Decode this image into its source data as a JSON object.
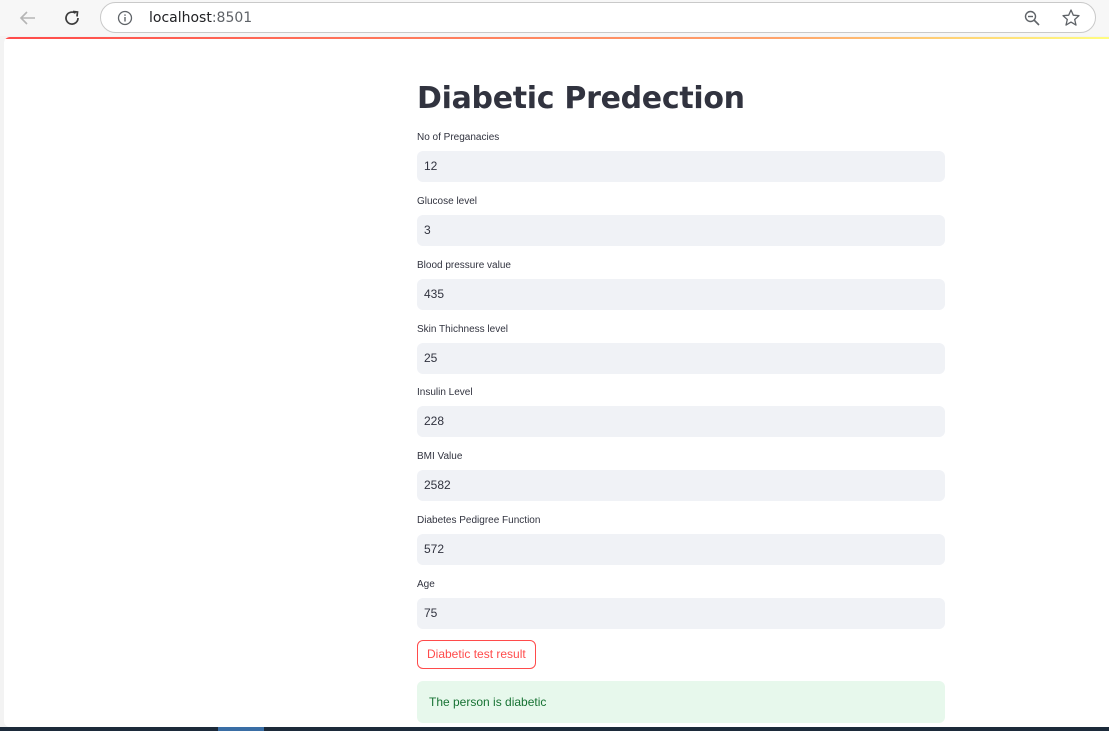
{
  "browser": {
    "url_host": "localhost",
    "url_port": ":8501",
    "icons": [
      "back-arrow-icon",
      "reload-icon",
      "info-icon",
      "zoom-out-icon",
      "star-icon"
    ]
  },
  "app": {
    "title": "Diabetic Predection",
    "fields": [
      {
        "label": "No of Preganacies",
        "value": "12"
      },
      {
        "label": "Glucose level",
        "value": "3"
      },
      {
        "label": "Blood pressure value",
        "value": "435"
      },
      {
        "label": "Skin Thichness level",
        "value": "25"
      },
      {
        "label": "Insulin Level",
        "value": "228"
      },
      {
        "label": "BMI Value",
        "value": "2582"
      },
      {
        "label": "Diabetes Pedigree Function",
        "value": "572"
      },
      {
        "label": "Age",
        "value": "75"
      }
    ],
    "button_label": "Diabetic test result",
    "result_text": "The person is diabetic"
  },
  "colors": {
    "primary": "#ff4b4b",
    "input_bg": "#f0f2f6",
    "success_bg": "#e7f8ec",
    "success_text": "#177233",
    "text": "#31333f"
  }
}
